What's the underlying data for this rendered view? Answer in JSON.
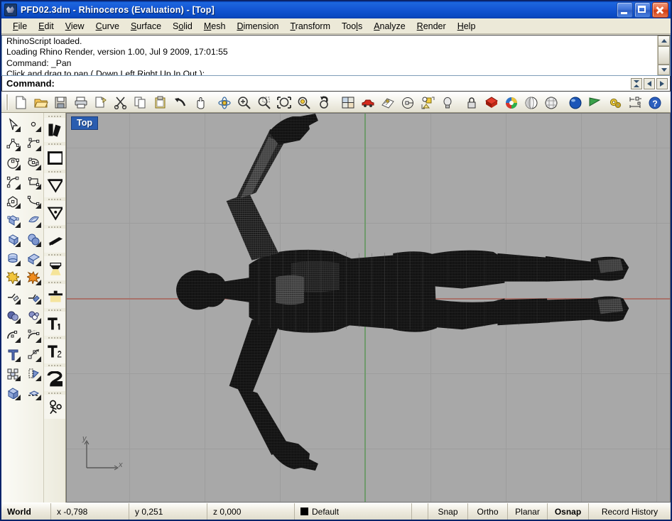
{
  "window": {
    "title": "PFD02.3dm - Rhinoceros (Evaluation) - [Top]",
    "icon": "rhino-app-icon",
    "controls": {
      "minimize": "minimize-button",
      "maximize": "maximize-button",
      "close": "close-button"
    }
  },
  "menubar": {
    "items": [
      {
        "label": "File",
        "accel": "F"
      },
      {
        "label": "Edit",
        "accel": "E"
      },
      {
        "label": "View",
        "accel": "V"
      },
      {
        "label": "Curve",
        "accel": "C"
      },
      {
        "label": "Surface",
        "accel": "S"
      },
      {
        "label": "Solid",
        "accel": "o"
      },
      {
        "label": "Mesh",
        "accel": "M"
      },
      {
        "label": "Dimension",
        "accel": "D"
      },
      {
        "label": "Transform",
        "accel": "T"
      },
      {
        "label": "Tools",
        "accel": "l"
      },
      {
        "label": "Analyze",
        "accel": "A"
      },
      {
        "label": "Render",
        "accel": "R"
      },
      {
        "label": "Help",
        "accel": "H"
      }
    ]
  },
  "command_history": {
    "lines": [
      "RhinoScript loaded.",
      "Loading Rhino Render, version 1.00, Jul  9 2009, 17:01:55",
      "Command: _Pan",
      "Click and drag to pan ( Down  Left  Right  Up  In  Out ):"
    ]
  },
  "command_line": {
    "prompt": "Command:",
    "value": "",
    "placeholder": "",
    "buttons": [
      "command-history-button",
      "command-back-button",
      "command-forward-button"
    ]
  },
  "toolbar": {
    "buttons": [
      {
        "name": "new-file-icon",
        "label": "New"
      },
      {
        "name": "open-file-icon",
        "label": "Open"
      },
      {
        "name": "save-file-icon",
        "label": "Save"
      },
      {
        "name": "print-icon",
        "label": "Print"
      },
      {
        "name": "cut-paste-layout-icon",
        "label": "Copy to clipboard"
      },
      {
        "name": "scissors-cut-icon",
        "label": "Cut"
      },
      {
        "name": "copy-icon",
        "label": "Copy"
      },
      {
        "name": "paste-icon",
        "label": "Paste"
      },
      {
        "name": "undo-arrow-icon",
        "label": "Undo"
      },
      {
        "name": "pan-hand-icon",
        "label": "Pan"
      },
      {
        "name": "rotate-view-icon",
        "label": "Rotate view"
      },
      {
        "name": "zoom-in-icon",
        "label": "Zoom in"
      },
      {
        "name": "zoom-window-icon",
        "label": "Zoom window"
      },
      {
        "name": "zoom-extents-icon",
        "label": "Zoom extents"
      },
      {
        "name": "zoom-selected-icon",
        "label": "Zoom selected"
      },
      {
        "name": "zoom-previous-icon",
        "label": "Zoom previous"
      },
      {
        "name": "four-viewport-icon",
        "label": "4 viewports"
      },
      {
        "name": "car-render-icon",
        "label": "Render"
      },
      {
        "name": "layout-sheet-icon",
        "label": "Layout"
      },
      {
        "name": "named-view-icon",
        "label": "Named views"
      },
      {
        "name": "object-snap-icon",
        "label": "Object snap"
      },
      {
        "name": "lightbulb-icon",
        "label": "Lights"
      },
      {
        "name": "lock-icon",
        "label": "Lock"
      },
      {
        "name": "color-gem-icon",
        "label": "Material"
      },
      {
        "name": "color-wheel-icon",
        "label": "Colors"
      },
      {
        "name": "shade-sphere-icon",
        "label": "Shaded"
      },
      {
        "name": "ghosted-sphere-icon",
        "label": "Ghosted"
      },
      {
        "name": "render-sphere-icon",
        "label": "Rendered"
      },
      {
        "name": "flag-marker-icon",
        "label": "Flag"
      },
      {
        "name": "gears-options-icon",
        "label": "Options"
      },
      {
        "name": "dimension-tool-icon",
        "label": "Dimension"
      },
      {
        "name": "help-icon",
        "label": "Help"
      }
    ]
  },
  "sidebar": {
    "column1": [
      {
        "name": "select-arrow-icon",
        "label": "Select objects"
      },
      {
        "name": "polyline-icon",
        "label": "Polyline"
      },
      {
        "name": "circle-icon",
        "label": "Circle"
      },
      {
        "name": "arc-icon",
        "label": "Arc"
      },
      {
        "name": "polygon-icon",
        "label": "Polygon"
      },
      {
        "name": "surface-corner-icon",
        "label": "Surface from corner points"
      },
      {
        "name": "box-solid-icon",
        "label": "Box"
      },
      {
        "name": "cylinder-solid-icon",
        "label": "Cylinder"
      },
      {
        "name": "explode-star-icon",
        "label": "Explode"
      },
      {
        "name": "trim-icon",
        "label": "Trim"
      },
      {
        "name": "boolean-union-icon",
        "label": "Boolean union"
      },
      {
        "name": "fillet-curve-icon",
        "label": "Fillet curves"
      },
      {
        "name": "text-object-icon",
        "label": "Text object"
      },
      {
        "name": "group-objects-icon",
        "label": "Group"
      },
      {
        "name": "solid-tools-icon",
        "label": "Solid tools"
      }
    ],
    "column2": [
      {
        "name": "point-icon",
        "label": "Point"
      },
      {
        "name": "curve-control-icon",
        "label": "Curve from control points"
      },
      {
        "name": "ellipse-icon",
        "label": "Ellipse"
      },
      {
        "name": "rectangle-icon",
        "label": "Rectangle"
      },
      {
        "name": "curve-blend-icon",
        "label": "Blend curve"
      },
      {
        "name": "surface-patch-icon",
        "label": "Surface patch"
      },
      {
        "name": "sphere-solid-icon",
        "label": "Sphere"
      },
      {
        "name": "extrude-surface-icon",
        "label": "Extrude surface"
      },
      {
        "name": "split-burst-icon",
        "label": "Split"
      },
      {
        "name": "boolean-split-icon",
        "label": "Boolean split"
      },
      {
        "name": "boolean-diff-icon",
        "label": "Boolean difference"
      },
      {
        "name": "blend-surface-icon",
        "label": "Blend surface"
      },
      {
        "name": "scale-transform-icon",
        "label": "Scale"
      },
      {
        "name": "offset-object-icon",
        "label": "Offset"
      },
      {
        "name": "planar-section-icon",
        "label": "Section"
      }
    ],
    "column3": [
      {
        "name": "layer-black-icon",
        "label": "Layers"
      },
      {
        "name": "rectangle-white-icon",
        "label": "Rectangle tools"
      },
      {
        "name": "cone-down-icon",
        "label": "Cone"
      },
      {
        "name": "cone-point-icon",
        "label": "Cone point"
      },
      {
        "name": "black-slab-icon",
        "label": "Slab"
      },
      {
        "name": "spotlight-icon",
        "label": "Spotlight"
      },
      {
        "name": "light-table-icon",
        "label": "Light"
      },
      {
        "name": "text-t1-icon",
        "label": "Text style 1"
      },
      {
        "name": "text-t2-icon",
        "label": "Text style 2"
      },
      {
        "name": "number-2-icon",
        "label": "Numbers"
      },
      {
        "name": "figure-sketch-icon",
        "label": "Sketch figure"
      }
    ]
  },
  "viewport": {
    "label": "Top",
    "background_color": "#a8a8a8",
    "axis_x_color": "#a8726b",
    "axis_y_color": "#6f9a6c",
    "grid_color": "#9d9d9d",
    "axis_indicator": {
      "x_label": "x",
      "y_label": "y"
    },
    "model": {
      "name": "human-figure-wireframe",
      "description": "Dense black wireframe mesh of a human figure, arms outstretched, top view"
    }
  },
  "statusbar": {
    "cs_label": "World",
    "x": "x -0,798",
    "y": "y 0,251",
    "z": "z 0,000",
    "layer": "Default",
    "layer_color": "#000000",
    "toggles": [
      {
        "label": "Snap",
        "active": false
      },
      {
        "label": "Ortho",
        "active": false
      },
      {
        "label": "Planar",
        "active": false
      },
      {
        "label": "Osnap",
        "active": true
      },
      {
        "label": "Record History",
        "active": false
      }
    ]
  }
}
